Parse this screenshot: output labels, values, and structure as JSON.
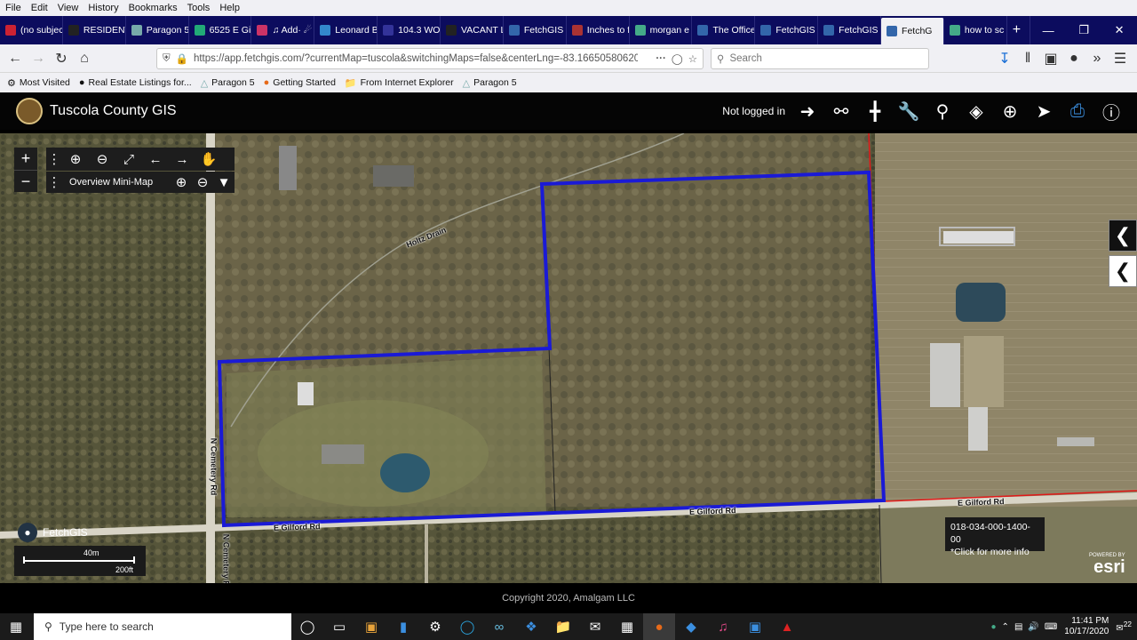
{
  "menu": [
    "File",
    "Edit",
    "View",
    "History",
    "Bookmarks",
    "Tools",
    "Help"
  ],
  "tabs": [
    {
      "label": "(no subjec",
      "color": "#c23"
    },
    {
      "label": "RESIDENTI",
      "color": "#222"
    },
    {
      "label": "Paragon 5",
      "color": "#7aa"
    },
    {
      "label": "6525 E Gilf",
      "color": "#2a7"
    },
    {
      "label": "♫ Add· ☄",
      "color": "#c36"
    },
    {
      "label": "Leonard B",
      "color": "#38c"
    },
    {
      "label": "104.3 WO",
      "color": "#339"
    },
    {
      "label": "VACANT L",
      "color": "#222"
    },
    {
      "label": "FetchGIS",
      "color": "#36a"
    },
    {
      "label": "Inches to f",
      "color": "#a33"
    },
    {
      "label": "morgan e",
      "color": "#4a8"
    },
    {
      "label": "The Office",
      "color": "#36a"
    },
    {
      "label": "FetchGIS",
      "color": "#36a"
    },
    {
      "label": "FetchGIS",
      "color": "#36a"
    },
    {
      "label": "FetchG",
      "color": "#36a",
      "active": true
    },
    {
      "label": "how to sc",
      "color": "#4a8"
    }
  ],
  "nav": {
    "url": "https://app.fetchgis.com/?currentMap=tuscola&switchingMaps=false&centerLng=-83.16650580620",
    "search_placeholder": "Search"
  },
  "bookmarks": [
    "Most Visited",
    "Real Estate Listings for...",
    "Paragon 5",
    "Getting Started",
    "From Internet Explorer",
    "Paragon 5"
  ],
  "app": {
    "title": "Tuscola County GIS",
    "login_status": "Not logged in",
    "header_icons": [
      "login-icon",
      "link-icon",
      "road-icon",
      "wrench-icon",
      "search-icon",
      "layers-icon",
      "gps-icon",
      "send-icon",
      "print-icon",
      "help-icon"
    ]
  },
  "map": {
    "overview_label": "Overview Mini-Map",
    "brand": "FetchGIS",
    "scale_top": "40m",
    "scale_bottom": "200ft",
    "roads": {
      "holtz_drain": "Holtz Drain",
      "gilford_rd_1": "E Gilford Rd",
      "gilford_rd_2": "E Gilford Rd",
      "gilford_rd_3": "E Gilford Rd",
      "cemetery_rd": "N Cemetery Rd",
      "cemetery_rd_2": "N Cemetery Rd"
    },
    "parcel_id": "018-034-000-1400-00",
    "parcel_hint": "*Click for more info",
    "esri_powered": "POWERED BY",
    "esri": "esri",
    "colors": {
      "parcel": "#1a1ad6",
      "boundary": "#e01818"
    }
  },
  "footer": {
    "copyright": "Copyright 2020, Amalgam LLC"
  },
  "taskbar": {
    "search_placeholder": "Type here to search",
    "time": "11:41 PM",
    "date": "10/17/2020",
    "notif_count": "22"
  }
}
